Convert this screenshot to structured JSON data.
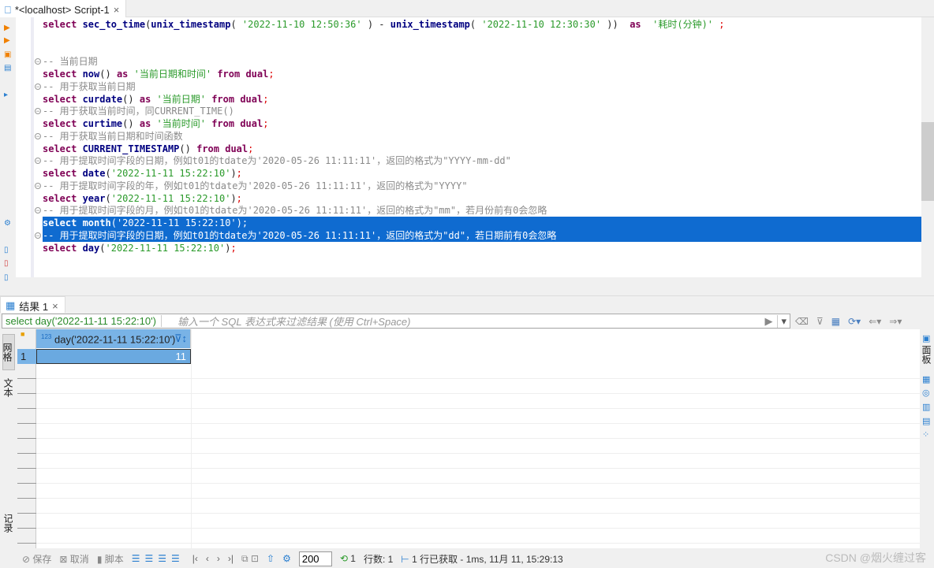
{
  "tab": {
    "title": "*<localhost> Script-1",
    "close": "×"
  },
  "editor": {
    "lines": [
      [
        [
          "kw",
          "select "
        ],
        [
          "fn",
          "sec_to_time"
        ],
        [
          "pu",
          "("
        ],
        [
          "fn",
          "unix_timestamp"
        ],
        [
          "pu",
          "( "
        ],
        [
          "st",
          "'2022-11-10 12:50:36'"
        ],
        [
          "pu",
          " ) - "
        ],
        [
          "fn",
          "unix_timestamp"
        ],
        [
          "pu",
          "( "
        ],
        [
          "st",
          "'2022-11-10 12:30:30'"
        ],
        [
          "pu",
          " ))  "
        ],
        [
          "kw",
          "as "
        ],
        [
          "st",
          " '耗时(分钟)'"
        ],
        [
          "sc",
          " ;"
        ]
      ],
      [],
      [],
      [
        [
          "cm",
          "-- 当前日期"
        ]
      ],
      [
        [
          "kw",
          "select "
        ],
        [
          "fn",
          "now"
        ],
        [
          "pu",
          "() "
        ],
        [
          "kw",
          "as "
        ],
        [
          "st",
          "'当前日期和时间'"
        ],
        [
          "kw",
          " from dual"
        ],
        [
          "sc",
          ";"
        ]
      ],
      [
        [
          "cm",
          "-- 用于获取当前日期"
        ]
      ],
      [
        [
          "kw",
          "select "
        ],
        [
          "fn",
          "curdate"
        ],
        [
          "pu",
          "() "
        ],
        [
          "kw",
          "as "
        ],
        [
          "st",
          "'当前日期'"
        ],
        [
          "kw",
          " from dual"
        ],
        [
          "sc",
          ";"
        ]
      ],
      [
        [
          "cm",
          "-- 用于获取当前时间，同CURRENT_TIME()"
        ]
      ],
      [
        [
          "kw",
          "select "
        ],
        [
          "fn",
          "curtime"
        ],
        [
          "pu",
          "() "
        ],
        [
          "kw",
          "as "
        ],
        [
          "st",
          "'当前时间'"
        ],
        [
          "kw",
          " from dual"
        ],
        [
          "sc",
          ";"
        ]
      ],
      [
        [
          "cm",
          "-- 用于获取当前日期和时间函数"
        ]
      ],
      [
        [
          "kw",
          "select "
        ],
        [
          "fn",
          "CURRENT_TIMESTAMP"
        ],
        [
          "pu",
          "() "
        ],
        [
          "kw",
          "from dual"
        ],
        [
          "sc",
          ";"
        ]
      ],
      [
        [
          "cm",
          "-- 用于提取时间字段的日期，例如t01的tdate为'2020-05-26 11:11:11'，返回的格式为\"YYYY-mm-dd\""
        ]
      ],
      [
        [
          "kw",
          "select "
        ],
        [
          "fn",
          "date"
        ],
        [
          "pu",
          "("
        ],
        [
          "st",
          "'2022-11-11 15:22:10'"
        ],
        [
          "pu",
          ")"
        ],
        [
          "sc",
          ";"
        ]
      ],
      [
        [
          "cm",
          "-- 用于提取时间字段的年，例如t01的tdate为'2020-05-26 11:11:11'，返回的格式为\"YYYY\""
        ]
      ],
      [
        [
          "kw",
          "select "
        ],
        [
          "fn",
          "year"
        ],
        [
          "pu",
          "("
        ],
        [
          "st",
          "'2022-11-11 15:22:10'"
        ],
        [
          "pu",
          ")"
        ],
        [
          "sc",
          ";"
        ]
      ],
      [
        [
          "cm",
          "-- 用于提取时间字段的月，例如t01的tdate为'2020-05-26 11:11:11'，返回的格式为\"mm\"，若月份前有0会忽略"
        ]
      ],
      [
        [
          "kw",
          "select "
        ],
        [
          "fn",
          "month"
        ],
        [
          "pu",
          "("
        ],
        [
          "st",
          "'2022-11-11 15:22:10'"
        ],
        [
          "pu",
          ")"
        ],
        [
          "sc",
          ";"
        ]
      ],
      [
        [
          "cm",
          "-- 用于提取时间字段的日期，例如t01的tdate为'2020-05-26 11:11:11'，返回的格式为\"dd\"，若日期前有0会忽略"
        ]
      ],
      [
        [
          "kw",
          "select "
        ],
        [
          "fn",
          "day"
        ],
        [
          "pu",
          "("
        ],
        [
          "st",
          "'2022-11-11 15:22:10'"
        ],
        [
          "pu",
          ")"
        ],
        [
          "sc",
          ";"
        ]
      ]
    ],
    "selected_lines": [
      17,
      18
    ]
  },
  "results": {
    "tab_label": "结果 1",
    "query": "select day('2022-11-11 15:22:10')",
    "filter_placeholder": "输入一个 SQL 表达式来过滤结果 (使用 Ctrl+Space)",
    "column_type": "123",
    "column": "day('2022-11-11 15:22:10')",
    "rows": [
      {
        "num": "1",
        "value": "11"
      }
    ],
    "left_tabs": [
      "网格",
      "文本",
      "记录"
    ],
    "right_tab": "面板"
  },
  "status": {
    "save": "保存",
    "cancel": "取消",
    "script": "脚本",
    "fetch_size": "200",
    "refresh_count": "1",
    "row_count": "行数: 1",
    "fetched": "1 行已获取 - 1ms, 11月 11, 15:29:13"
  },
  "watermark": "CSDN @烟火缠过客",
  "colors": {
    "selection": "#0f6bd0",
    "header": "#79b3e6",
    "cell": "#6aa9e0",
    "keyword": "#7f0055",
    "string": "#2a9a2a",
    "comment": "#8a8a8a"
  }
}
